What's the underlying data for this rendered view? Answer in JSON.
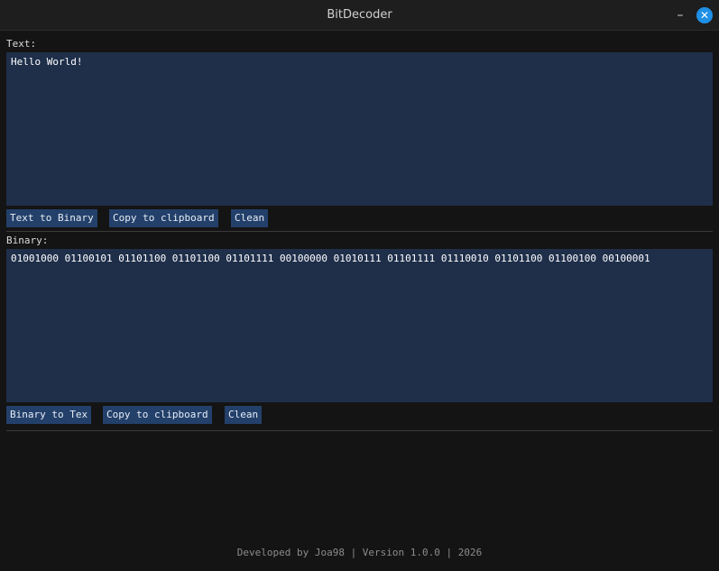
{
  "window": {
    "title": "BitDecoder",
    "minimize_glyph": "–",
    "close_glyph": "✕"
  },
  "text_section": {
    "label": "Text:",
    "value": "Hello World!",
    "buttons": {
      "convert": "Text to Binary",
      "copy": "Copy to clipboard",
      "clean": "Clean"
    }
  },
  "binary_section": {
    "label": "Binary:",
    "value": "01001000 01100101 01101100 01101100 01101111 00100000 01010111 01101111 01110010 01101100 01100100 00100001",
    "buttons": {
      "convert": "Binary to Tex",
      "copy": "Copy to clipboard",
      "clean": "Clean"
    }
  },
  "footer": {
    "text": "Developed by Joa98 | Version 1.0.0 | 2026"
  },
  "colors": {
    "window_bg": "#141414",
    "textbox_bg": "#1f2f4a",
    "button_bg": "#23406a",
    "close_button": "#1e90e6"
  }
}
